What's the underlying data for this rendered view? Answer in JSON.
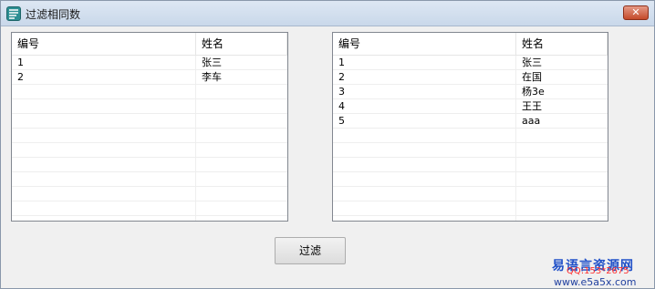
{
  "window": {
    "title": "过滤相同数",
    "close_label": "✕"
  },
  "left_list": {
    "columns": [
      "编号",
      "姓名"
    ],
    "rows": [
      [
        "1",
        "张三"
      ],
      [
        "2",
        "李车"
      ]
    ]
  },
  "right_list": {
    "columns": [
      "编号",
      "姓名"
    ],
    "rows": [
      [
        "1",
        "张三"
      ],
      [
        "2",
        "在国"
      ],
      [
        "3",
        "杨3e"
      ],
      [
        "4",
        "王王"
      ],
      [
        "5",
        "aaa"
      ]
    ]
  },
  "buttons": {
    "filter_label": "过滤"
  },
  "watermark": {
    "name": "易语言资源网",
    "qq": "QQ:153*2675",
    "url": "www.e5a5x.com"
  },
  "colors": {
    "titlebar": "#c9d8ea",
    "close": "#c44a2a",
    "watermark_blue": "#2050c8"
  }
}
